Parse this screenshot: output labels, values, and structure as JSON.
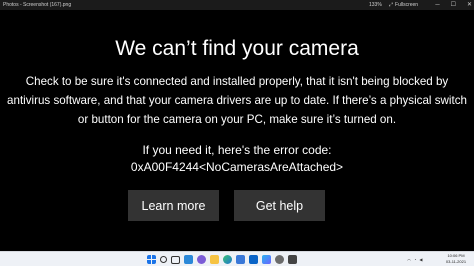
{
  "window": {
    "title": "Photos - Screenshot (167).png",
    "zoom": "133%",
    "fullscreen_label": "Fullscreen"
  },
  "error": {
    "heading": "We can’t find your camera",
    "body": "Check to be sure it's connected and installed properly, that it isn't being blocked by antivirus software, and that your camera drivers are up to date. If there’s a physical switch or button for the camera on your PC, make sure it’s turned on.",
    "code_intro": "If you need it, here's the error code:",
    "code": "0xA00F4244<NoCamerasAreAttached>",
    "learn_more": "Learn more",
    "get_help": "Get help"
  },
  "taskbar": {
    "time": "10:06 PM",
    "date": "03-11-2021",
    "icons": [
      "windows-icon",
      "search-icon",
      "task-view-icon",
      "widgets-icon",
      "chat-icon",
      "file-explorer-icon",
      "edge-icon",
      "store-icon",
      "mail-icon",
      "photos-icon",
      "settings-icon",
      "camera-icon"
    ]
  },
  "colors": {
    "background": "#000000",
    "button": "#333333",
    "text": "#ffffff",
    "taskbar": "#eef1f6"
  }
}
